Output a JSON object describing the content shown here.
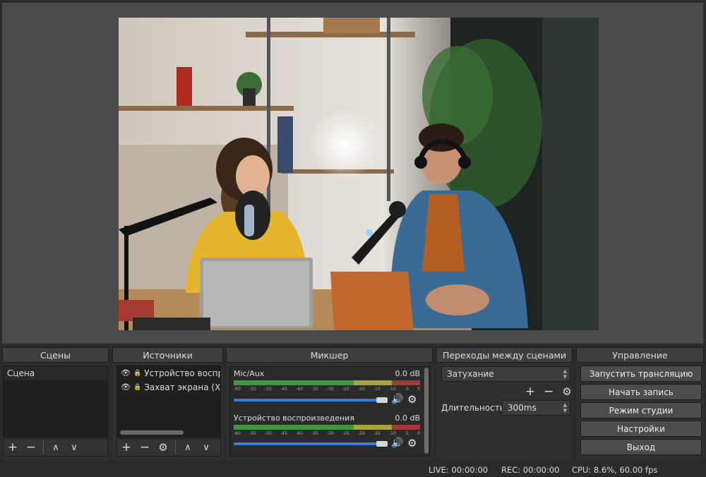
{
  "panels": {
    "scenes": {
      "title": "Сцены",
      "items": [
        "Сцена"
      ]
    },
    "sources": {
      "title": "Источники",
      "items": [
        "Устройство воспро",
        "Захват экрана (XSH"
      ]
    },
    "mixer": {
      "title": "Микшер",
      "channels": [
        {
          "name": "Mic/Aux",
          "db": "0.0 dB"
        },
        {
          "name": "Устройство воспроизведения",
          "db": "0.0 dB"
        }
      ],
      "ticks": [
        "-60",
        "-55",
        "-50",
        "-45",
        "-40",
        "-35",
        "-30",
        "-25",
        "-20",
        "-15",
        "-10",
        "-5",
        "0"
      ]
    },
    "transitions": {
      "title": "Переходы между сценами",
      "selected": "Затухание",
      "duration_label": "Длительность",
      "duration_value": "300ms"
    },
    "controls": {
      "title": "Управление",
      "start_stream": "Запустить трансляцию",
      "start_record": "Начать запись",
      "studio_mode": "Режим студии",
      "settings": "Настройки",
      "exit": "Выход"
    }
  },
  "status": {
    "live": "LIVE: 00:00:00",
    "rec": "REC: 00:00:00",
    "cpu": "CPU: 8.6%, 60.00 fps"
  },
  "colors": {
    "meter_green": "#3f9a3f",
    "meter_yellow": "#a8a33a",
    "meter_red": "#a33a3a",
    "slider_blue": "#3d7bd8"
  },
  "icons": {
    "add": "+",
    "remove": "−",
    "up": "∧",
    "down": "∨",
    "gear": "⚙",
    "speaker": "🔊",
    "eye": "👁",
    "lock": "🔒"
  }
}
